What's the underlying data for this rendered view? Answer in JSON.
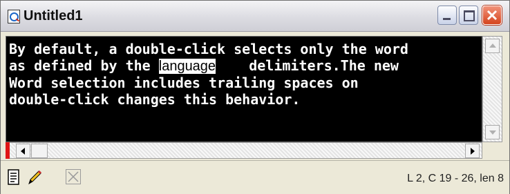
{
  "window": {
    "title": "Untitled1"
  },
  "editor": {
    "line1": "By default, a double-click selects only the word",
    "line2_before": "as defined by the ",
    "line2_selected": "language",
    "line2_after": "    delimiters.The new",
    "line3": "Word selection includes trailing spaces on",
    "line4": "double-click changes this behavior.",
    "background": "#000000",
    "text_color": "#ffffff"
  },
  "statusbar": {
    "position": "L 2,  C 19 - 26, len 8"
  },
  "icons": [
    "app-icon",
    "minimize-icon",
    "maximize-icon",
    "close-icon",
    "document-icon",
    "pencil-icon",
    "disabled-x-icon"
  ]
}
